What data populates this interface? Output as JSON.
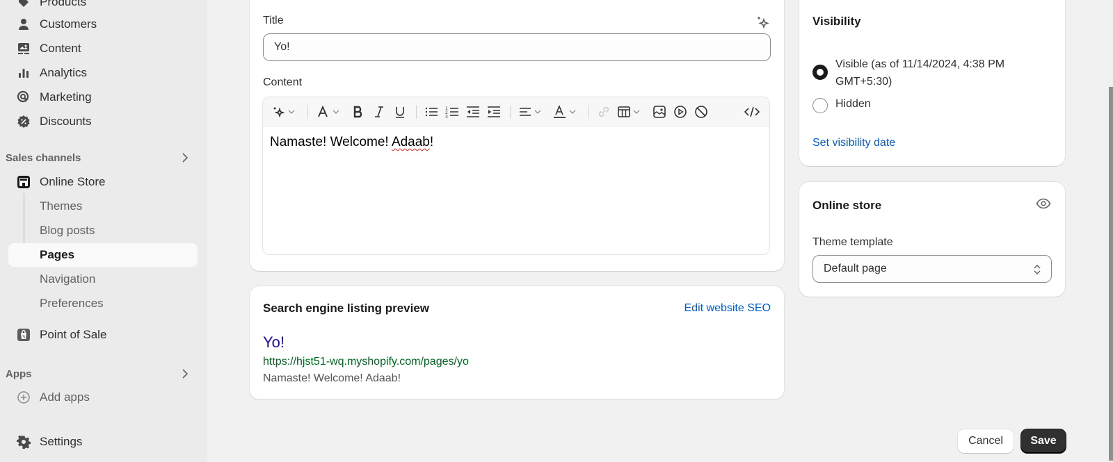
{
  "sidebar": {
    "items": [
      {
        "label": "Products",
        "icon": "tag-icon"
      },
      {
        "label": "Customers",
        "icon": "person-icon"
      },
      {
        "label": "Content",
        "icon": "content-icon"
      },
      {
        "label": "Analytics",
        "icon": "bar-chart-icon"
      },
      {
        "label": "Marketing",
        "icon": "target-icon"
      },
      {
        "label": "Discounts",
        "icon": "discount-icon"
      }
    ],
    "sales_channels": {
      "heading": "Sales channels",
      "online_store": "Online Store",
      "sub_items": [
        "Themes",
        "Blog posts",
        "Pages",
        "Navigation",
        "Preferences"
      ],
      "active": "Pages",
      "point_of_sale": "Point of Sale"
    },
    "apps": {
      "heading": "Apps",
      "add_apps": "Add apps"
    },
    "settings": "Settings"
  },
  "page_editor": {
    "title_label": "Title",
    "title_value": "Yo!",
    "content_label": "Content",
    "content_text_before": "Namaste! Welcome! ",
    "content_misspelled": "Adaab",
    "content_text_after": "!",
    "toolbar": [
      "magic-icon",
      "text-style-icon",
      "bold-icon",
      "italic-icon",
      "underline-icon",
      "bulleted-list-icon",
      "numbered-list-icon",
      "outdent-icon",
      "indent-icon",
      "align-icon",
      "text-color-icon",
      "link-icon",
      "table-icon",
      "image-icon",
      "video-icon",
      "clear-format-icon",
      "code-icon"
    ]
  },
  "seo": {
    "heading": "Search engine listing preview",
    "edit_link": "Edit website SEO",
    "preview_title": "Yo!",
    "preview_url": "https://hjst51-wq.myshopify.com/pages/yo",
    "preview_description": "Namaste! Welcome! Adaab!"
  },
  "visibility": {
    "heading": "Visibility",
    "options": [
      {
        "label_line1": "Visible (as of 11/14/2024, 4:38 PM",
        "label_line2": "GMT+5:30)",
        "selected": true
      },
      {
        "label_line1": "Hidden",
        "selected": false
      }
    ],
    "set_date_link": "Set visibility date"
  },
  "online_store_card": {
    "heading": "Online store",
    "theme_template_label": "Theme template",
    "theme_template_value": "Default page"
  },
  "actions": {
    "cancel": "Cancel",
    "save": "Save"
  },
  "colors": {
    "link": "#005bd3",
    "seo_title": "#1a0dab",
    "seo_url": "#006621",
    "primary_button": "#303030"
  }
}
